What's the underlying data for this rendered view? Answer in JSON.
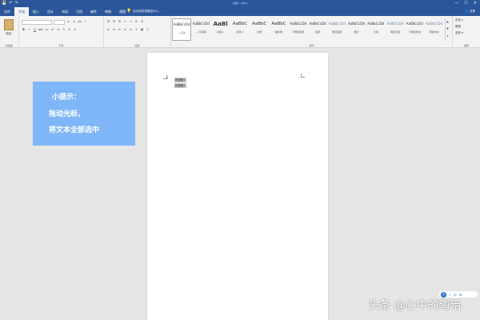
{
  "window": {
    "title": "文档1 - Word",
    "quick_access": [
      "💾",
      "↶",
      "↷"
    ],
    "controls": [
      "—",
      "☐",
      "✕"
    ]
  },
  "tabs": [
    {
      "label": "文件",
      "active": false
    },
    {
      "label": "开始",
      "active": true
    },
    {
      "label": "插入",
      "active": false
    },
    {
      "label": "设计",
      "active": false
    },
    {
      "label": "布局",
      "active": false
    },
    {
      "label": "引用",
      "active": false
    },
    {
      "label": "邮件",
      "active": false
    },
    {
      "label": "审阅",
      "active": false
    },
    {
      "label": "视图",
      "active": false
    }
  ],
  "tell_me": "告诉我您想要做什么...",
  "share_label": "共享",
  "ribbon": {
    "clipboard_label": "剪贴板",
    "paste_label": "粘贴",
    "font_label": "字体",
    "paragraph_label": "段落",
    "styles_label": "样式",
    "editing_label": "编辑",
    "styles": [
      {
        "sample": "AaBbCcDd",
        "name": "→ 正文",
        "size": "normal",
        "selected": true
      },
      {
        "sample": "AaBbCcDd",
        "name": "→ 无间隔",
        "size": "normal",
        "selected": false
      },
      {
        "sample": "AaBl",
        "name": "标题 1",
        "size": "big",
        "selected": false
      },
      {
        "sample": "AaBbC",
        "name": "标题 2",
        "size": "mid",
        "selected": false
      },
      {
        "sample": "AaBbC",
        "name": "标题",
        "size": "mid",
        "selected": false
      },
      {
        "sample": "AaBbC",
        "name": "副标题",
        "size": "mid",
        "selected": false
      },
      {
        "sample": "AaBbCcDd",
        "name": "不明显强调",
        "size": "normal",
        "selected": false
      },
      {
        "sample": "AaBbCcDd",
        "name": "强调",
        "size": "normal",
        "selected": false
      },
      {
        "sample": "AaBbCcDd",
        "name": "明显强调",
        "size": "light",
        "selected": false
      },
      {
        "sample": "AaBbCcDd",
        "name": "要点",
        "size": "normal",
        "selected": false
      },
      {
        "sample": "AaBbCcDd",
        "name": "引用",
        "size": "normal",
        "selected": false
      },
      {
        "sample": "AaBbCcDd",
        "name": "明显引用",
        "size": "light",
        "selected": false
      },
      {
        "sample": "AaBbCcDd",
        "name": "不明显参考",
        "size": "normal",
        "selected": false
      },
      {
        "sample": "AaBbCcDd",
        "name": "明显参考",
        "size": "light",
        "selected": false
      }
    ],
    "editing": {
      "find": "查找 ▾",
      "replace": "替换",
      "select": "选择 ▾"
    }
  },
  "document": {
    "selected_lines": [
      "按键盘1",
      "按键盘2"
    ]
  },
  "tip": {
    "line1": "小提示：",
    "line2": "拖动光标，",
    "line3": "将文本全部选中"
  },
  "assist": {
    "badge": "中",
    "items": [
      "♪",
      "☺",
      "⚙"
    ]
  },
  "watermark": "头条 @心中的晦暗",
  "colors": {
    "accent": "#2b579a",
    "tip_bg": "#7fb6f7"
  }
}
